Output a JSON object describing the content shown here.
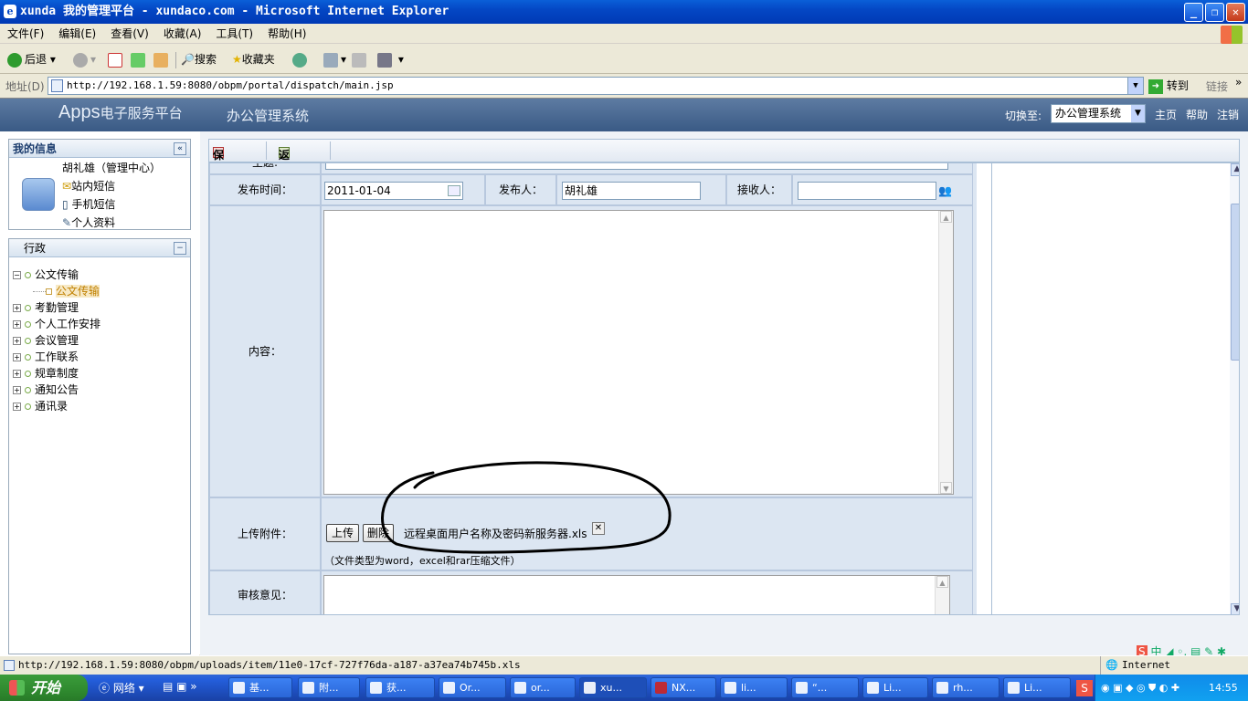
{
  "window": {
    "title": "xunda 我的管理平台 - xundaco.com - Microsoft Internet Explorer"
  },
  "menu": [
    "文件(F)",
    "编辑(E)",
    "查看(V)",
    "收藏(A)",
    "工具(T)",
    "帮助(H)"
  ],
  "toolbar": {
    "back": "后退",
    "search": "搜索",
    "favorites": "收藏夹"
  },
  "address": {
    "label": "地址(D)",
    "url": "http://192.168.1.59:8080/obpm/portal/dispatch/main.jsp",
    "go": "转到",
    "links": "链接"
  },
  "app": {
    "logo_main": "Apps",
    "logo_sub": "电子服务平台",
    "system": "办公管理系统",
    "switch_label": "切换至:",
    "switch_value": "办公管理系统",
    "home": "主页",
    "help": "帮助",
    "logout": "注销"
  },
  "myinfo": {
    "title": "我的信息",
    "user": "胡礼雄（管理中心）",
    "internal_msg": "站内短信",
    "sms": "手机短信",
    "profile": "个人资料"
  },
  "nav": {
    "title": "行政",
    "items": [
      {
        "label": "公文传输",
        "expanded": true,
        "children": [
          "公文传输"
        ]
      },
      {
        "label": "考勤管理"
      },
      {
        "label": "个人工作安排"
      },
      {
        "label": "会议管理"
      },
      {
        "label": "工作联系"
      },
      {
        "label": "规章制度"
      },
      {
        "label": "通知公告"
      },
      {
        "label": "通讯录"
      }
    ]
  },
  "actions": {
    "save": "保存",
    "back": "返回"
  },
  "form": {
    "subject_label": "主题:",
    "publish_time_label": "发布时间：",
    "publish_time": "2011-01-04",
    "publisher_label": "发布人：",
    "publisher": "胡礼雄",
    "receiver_label": "接收人：",
    "receiver": "",
    "content_label": "内容：",
    "attachment_label": "上传附件：",
    "upload_btn": "上传",
    "delete_btn": "删除",
    "file_name": "远程桌面用户名称及密码新服务器.xls",
    "file_hint": "（文件类型为word，excel和rar压缩文件）",
    "review_label": "审核意见："
  },
  "statusbar": {
    "url": "http://192.168.1.59:8080/obpm/uploads/item/11e0-17cf-727f76da-a187-a37ea74b745b.xls",
    "zone": "Internet"
  },
  "taskbar": {
    "start": "开始",
    "quicklaunch": "网络",
    "tasks": [
      "基...",
      "附...",
      "获...",
      "Or...",
      "or...",
      "xu...",
      "NX...",
      "li...",
      "“...",
      "Li...",
      "rh...",
      "Li..."
    ],
    "clock": "14:55"
  },
  "colors": {
    "title_blue": "#0447c4",
    "app_header": "#3a5a85",
    "form_bg": "#dce6f2"
  }
}
